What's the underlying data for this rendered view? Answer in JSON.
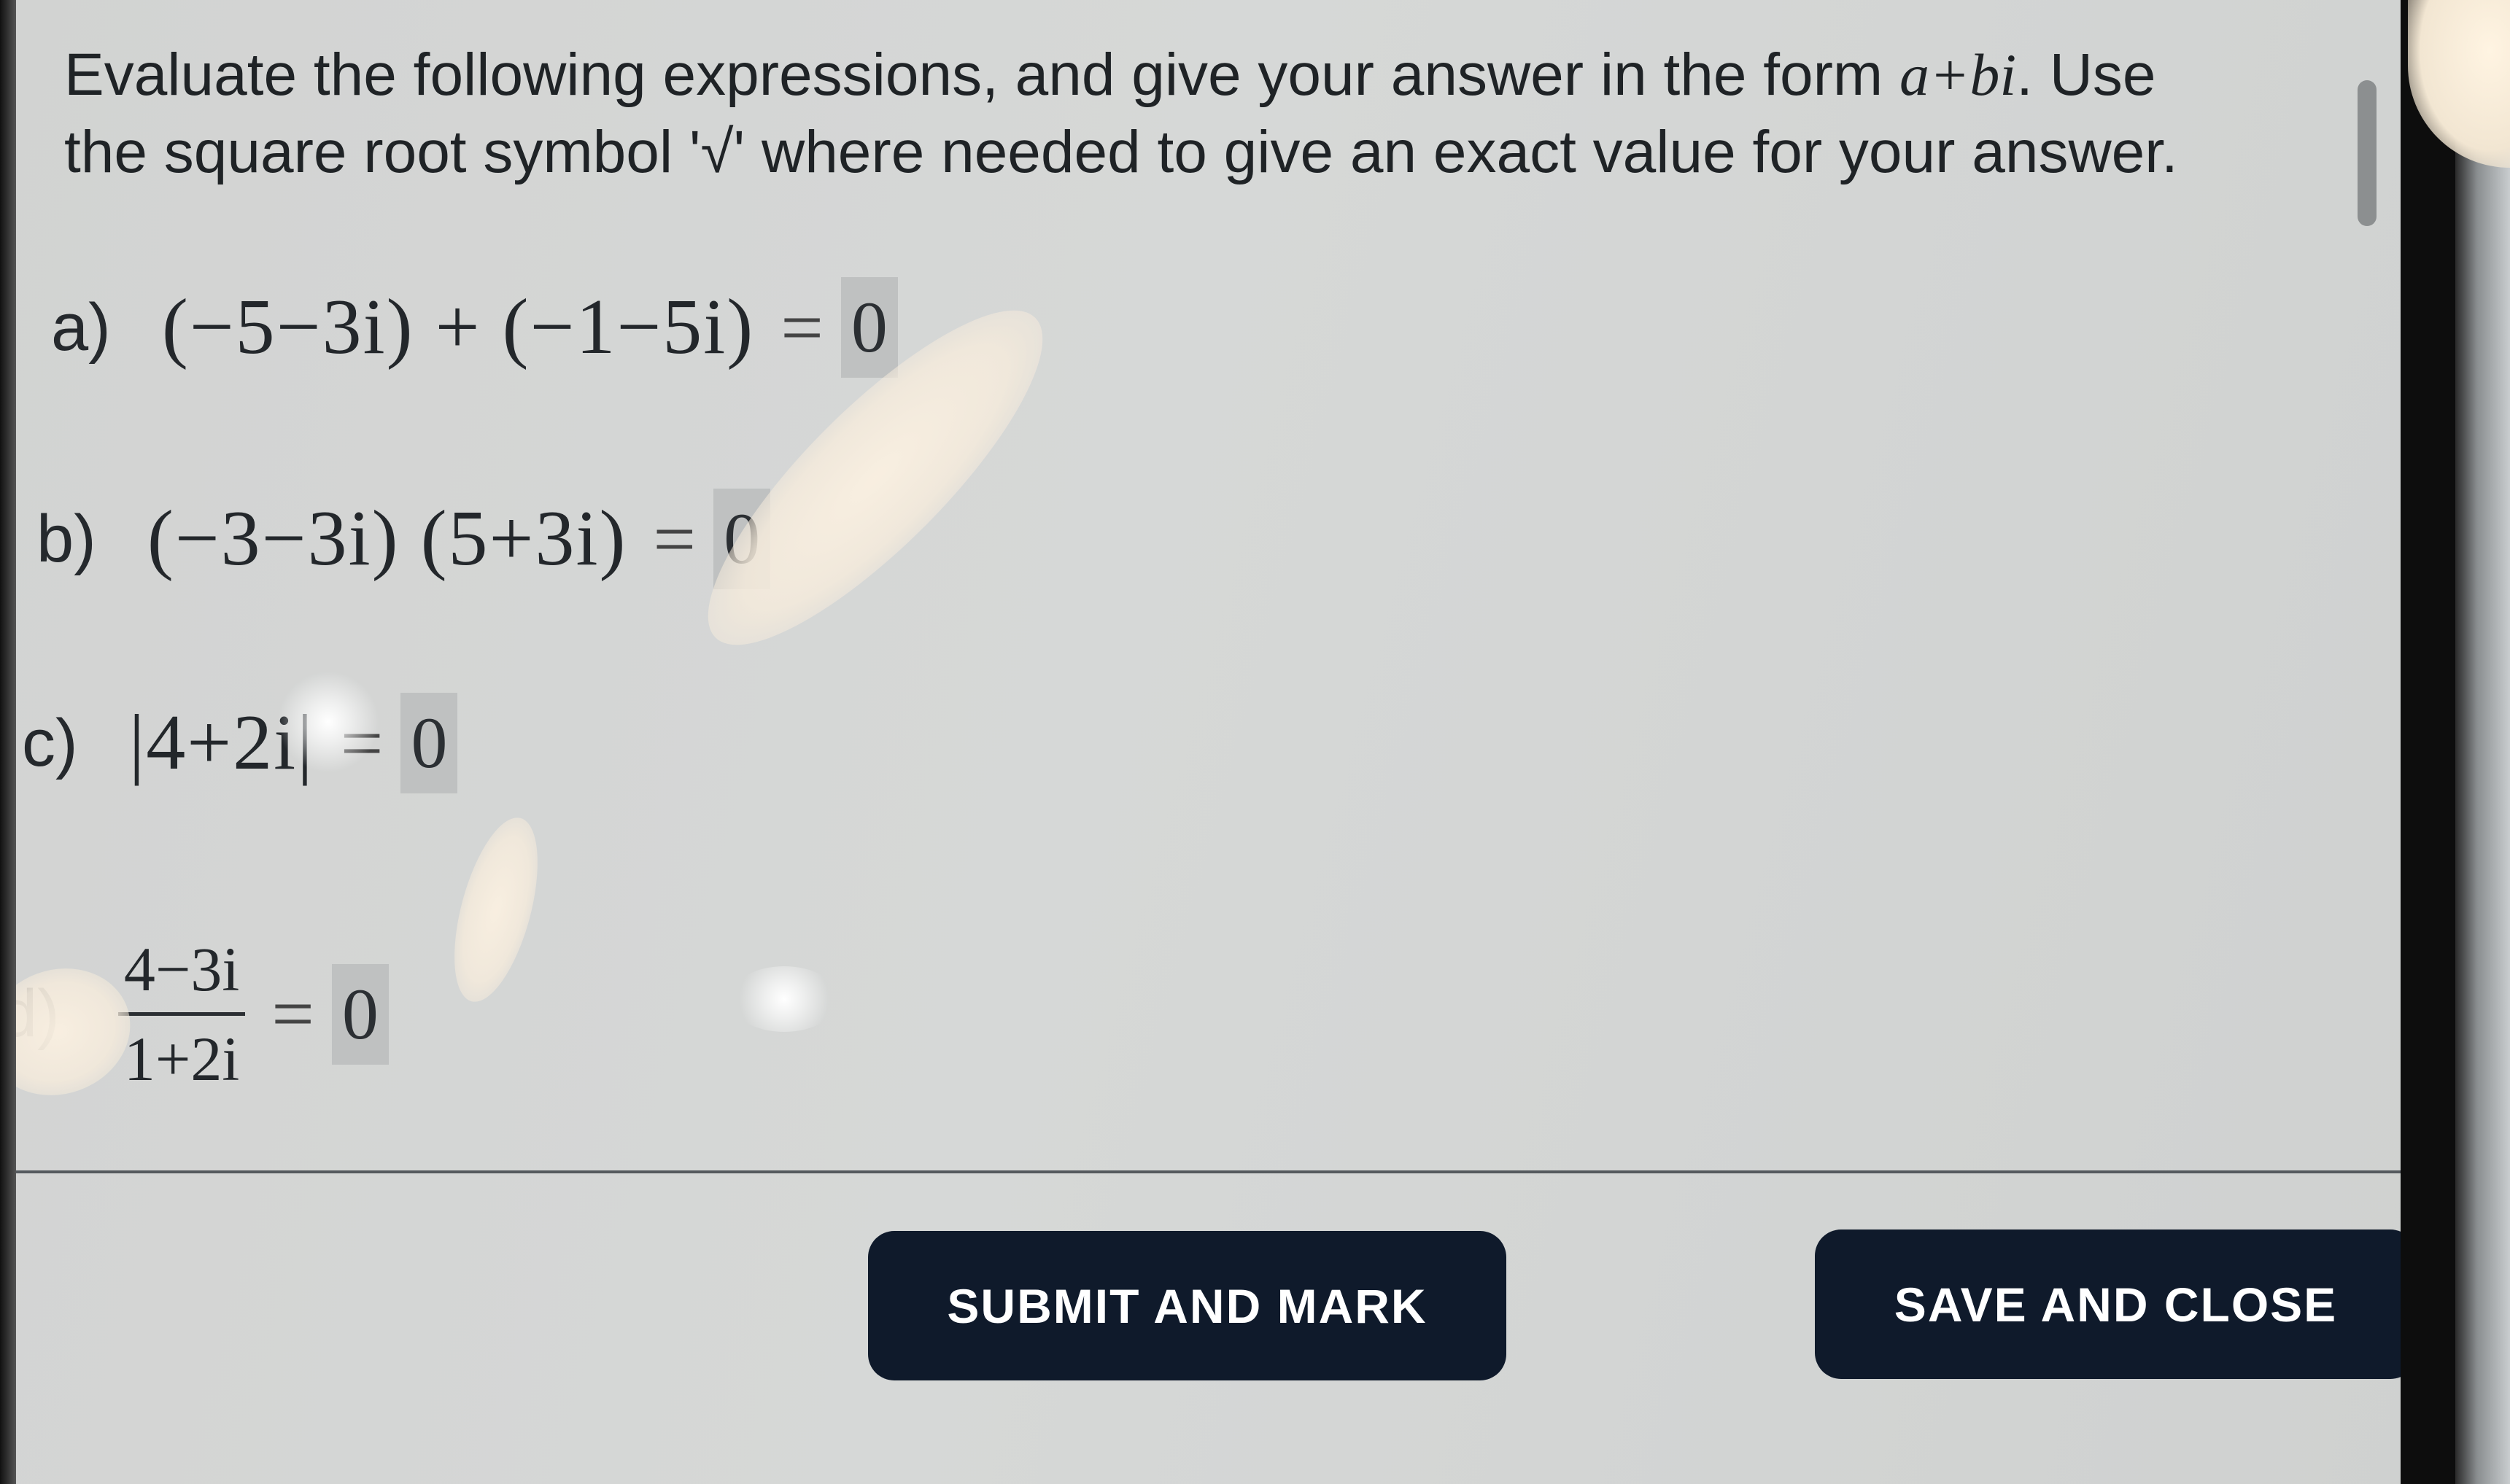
{
  "instructions": {
    "line1_prefix": "Evaluate the following expressions, and give your answer in the form ",
    "form": "a+bi",
    "line1_suffix": ". Use",
    "line2": "the square root symbol '√' where needed to give an exact value for your answer."
  },
  "questions": [
    {
      "label": "a)",
      "expression": "(−5−3i) + (−1−5i)",
      "equals": "=",
      "answer": "0"
    },
    {
      "label": "b)",
      "expression": "(−3−3i) (5+3i)",
      "equals": "=",
      "answer": "0"
    },
    {
      "label": "c)",
      "expression": "|4+2i|",
      "equals": "=",
      "answer": "0"
    },
    {
      "label": "d)",
      "numerator": "4−3i",
      "denominator": "1+2i",
      "equals": "=",
      "answer": "0"
    }
  ],
  "buttons": {
    "submit_label": "SUBMIT AND MARK",
    "save_label": "SAVE AND CLOSE"
  },
  "colors": {
    "button_bg": "#0f1a2b",
    "button_text": "#ffffff",
    "answer_box_bg": "#bfc1c1"
  }
}
